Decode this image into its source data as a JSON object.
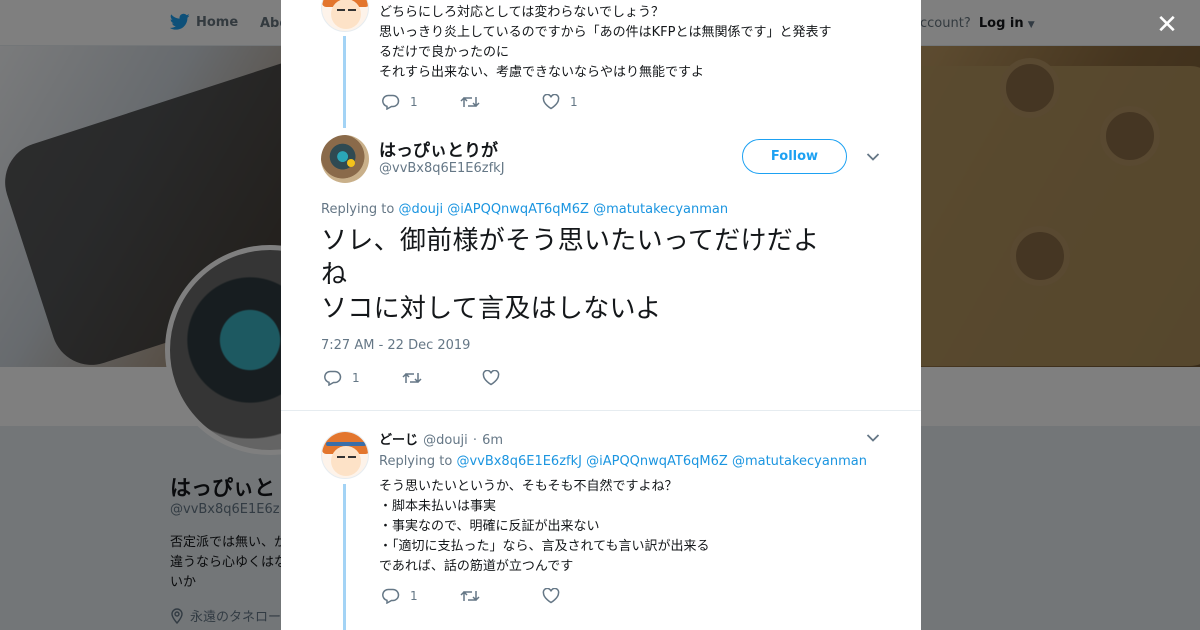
{
  "background": {
    "nav": {
      "home": "Home",
      "about": "Abo",
      "account_prompt": "ccount?",
      "login": "Log in"
    },
    "profile": {
      "name": "はっぴぃと",
      "handle": "@vvBx8q6E1E6z",
      "bio": "否定派では無い、が違うなら心ゆくはないか",
      "location": "永遠のタネロー"
    }
  },
  "modal": {
    "prev_tweet": {
      "lines": [
        "どちらにしろ対応としては変わらないでしょう？",
        "思いっきり炎上しているのですから「あの件はKFPとは無関係です」と発表す",
        "るだけで良かったのに",
        "それすら出来ない、考慮できないならやはり無能ですよ"
      ],
      "reply_count": "1",
      "retweet_count": "",
      "like_count": "1"
    },
    "main_tweet": {
      "name": "はっぴぃとりが",
      "handle": "@vvBx8q6E1E6zfkJ",
      "follow_label": "Follow",
      "replying_to_label": "Replying to",
      "mentions": [
        "@douji",
        "@iAPQQnwqAT6qM6Z",
        "@matutakecyanman"
      ],
      "text_lines": [
        "ソレ、御前様がそう思いたいってだけだよ",
        "ね",
        "ソコに対して言及はしないよ"
      ],
      "timestamp": "7:27 AM - 22 Dec 2019",
      "reply_count": "1"
    },
    "reply_tweet": {
      "name": "どーじ",
      "handle": "@douji",
      "separator": "·",
      "time": "6m",
      "replying_to_label": "Replying to",
      "mentions": [
        "@vvBx8q6E1E6zfkJ",
        "@iAPQQnwqAT6qM6Z",
        "@matutakecyanman"
      ],
      "lines": [
        "そう思いたいというか、そもそも不自然ですよね？",
        "・脚本未払いは事実",
        "・事実なので、明確に反証が出来ない",
        "・「適切に支払った」なら、言及されても言い訳が出来る",
        "であれば、話の筋道が立つんです"
      ],
      "reply_count": "1"
    }
  },
  "icons": {
    "twitter": "twitter-bird-icon",
    "close": "close-icon",
    "reply": "reply-icon",
    "retweet": "retweet-icon",
    "like": "heart-icon",
    "chevron": "chevron-down-icon",
    "location": "location-pin-icon"
  },
  "colors": {
    "accent": "#1da1f2",
    "link": "#1b95e0",
    "muted": "#657786",
    "thread": "#a3d3f5"
  }
}
